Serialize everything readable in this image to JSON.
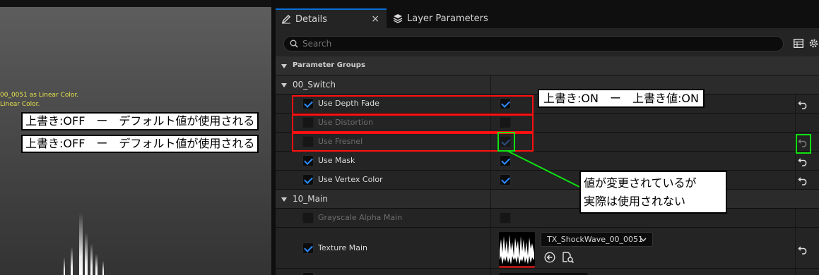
{
  "viewport": {
    "log_lines": [
      "00_0051 as Linear Color.",
      "Linear Color."
    ]
  },
  "tabs": [
    {
      "label": "Details",
      "icon": "pencil-icon",
      "active": true
    },
    {
      "label": "Layer Parameters",
      "icon": "layers-icon",
      "active": false
    }
  ],
  "search": {
    "placeholder": "Search",
    "value": ""
  },
  "parameter_groups_title": "Parameter Groups",
  "groups": [
    {
      "name": "00_Switch",
      "params": [
        {
          "label": "Use Depth Fade",
          "override": true,
          "value": true
        },
        {
          "label": "Use Distortion",
          "override": false,
          "value": false
        },
        {
          "label": "Use Fresnel",
          "override": false,
          "value": true
        },
        {
          "label": "Use Mask",
          "override": true,
          "value": true
        },
        {
          "label": "Use Vertex Color",
          "override": true,
          "value": true
        }
      ]
    },
    {
      "name": "10_Main",
      "params": [
        {
          "label": "Grayscale Alpha Main",
          "override": false,
          "value": false
        },
        {
          "label": "Texture Main",
          "override": true,
          "texture": "TX_ShockWave_00_0051"
        }
      ]
    }
  ],
  "annotations": {
    "note_on": "上書き:ON　ー　上書き値:ON",
    "note_off_1": "上書き:OFF　ー　デフォルト値が使用される",
    "note_off_2": "上書き:OFF　ー　デフォルト値が使用される",
    "note_green": [
      "値が変更されているが",
      "実際は使用されない"
    ]
  },
  "colors": {
    "accent": "#0b6fd8",
    "checkbox_check": "#2a8cff",
    "annotation_red": "#ff1010",
    "annotation_green": "#10e010"
  }
}
